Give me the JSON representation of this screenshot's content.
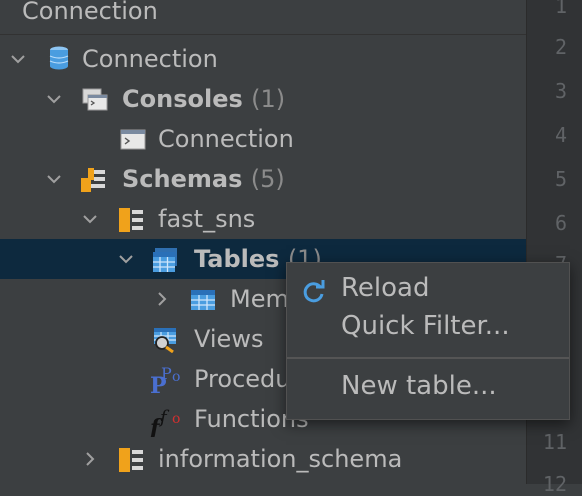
{
  "header": {
    "title": "Connection"
  },
  "tree": {
    "nodes": [
      {
        "label": "Connection",
        "icon": "database-icon"
      },
      {
        "label": "Consoles",
        "count": "(1)",
        "icon": "consoles-icon"
      },
      {
        "label": "Connection",
        "icon": "console-icon"
      },
      {
        "label": "Schemas",
        "count": "(5)",
        "icon": "schemas-icon"
      },
      {
        "label": "fast_sns",
        "icon": "schema-icon"
      },
      {
        "label": "Tables",
        "count": "(1)",
        "icon": "tables-icon"
      },
      {
        "label": "Mem",
        "icon": "table-icon"
      },
      {
        "label": "Views",
        "icon": "views-icon"
      },
      {
        "label": "Procedu",
        "icon": "procedures-icon"
      },
      {
        "label": "Functions",
        "icon": "functions-icon"
      },
      {
        "label": "information_schema",
        "icon": "schema-icon"
      }
    ]
  },
  "gutter": {
    "line_numbers": [
      "1",
      "2",
      "3",
      "4",
      "5",
      "6",
      "7",
      "11",
      "12"
    ]
  },
  "context_menu": {
    "items": [
      {
        "label": "Reload",
        "icon": "reload-icon"
      },
      {
        "label": "Quick Filter..."
      },
      {
        "label": "New table..."
      }
    ]
  },
  "colors": {
    "background": "#3c3f41",
    "selection": "#0d293e",
    "text": "#bbbbbb",
    "count": "#8b8b8b",
    "accent_blue": "#4a9de0",
    "schema_orange": "#f0a21b"
  }
}
